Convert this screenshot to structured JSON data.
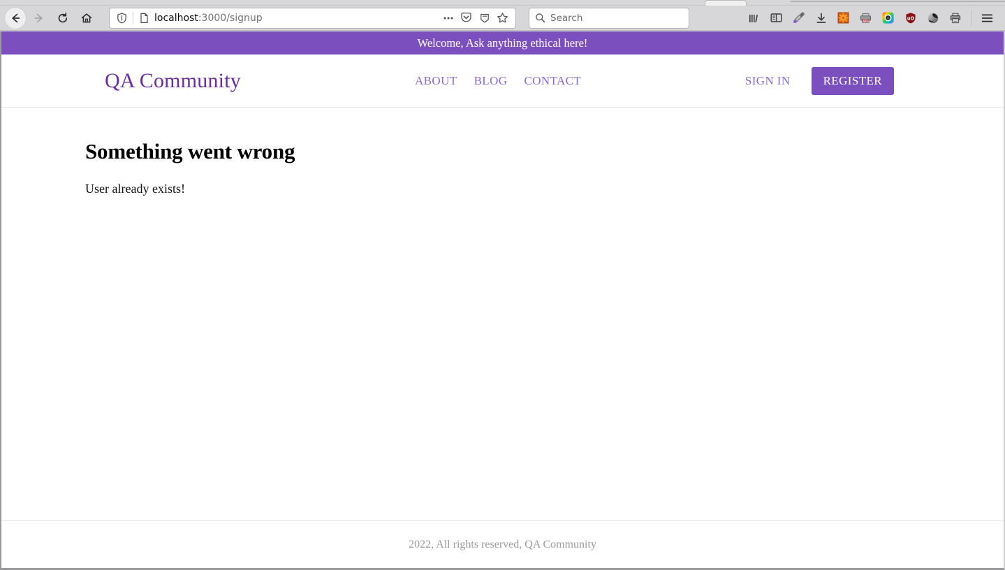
{
  "browser": {
    "nav": {
      "back_label": "Back",
      "forward_label": "Forward",
      "reload_label": "Reload",
      "home_label": "Home"
    },
    "url": {
      "host": "localhost",
      "path": ":3000/signup",
      "full": "localhost:3000/signup",
      "shield_label": "Tracking Protection",
      "page_info_label": "Page Info",
      "more_actions_label": "More actions",
      "pocket_label": "Save to Pocket",
      "reader_label": "Reader View",
      "bookmark_label": "Bookmark this page"
    },
    "search": {
      "placeholder": "Search",
      "value": ""
    },
    "extensions": [
      {
        "name": "library-icon",
        "label": "Library"
      },
      {
        "name": "sidebar-icon",
        "label": "Sidebars"
      },
      {
        "name": "eyedropper-icon",
        "label": "Eyedropper"
      },
      {
        "name": "download-icon",
        "label": "Downloads"
      },
      {
        "name": "orange-gear-icon",
        "label": "Settings Extension"
      },
      {
        "name": "pdf-printer-icon",
        "label": "Print to PDF"
      },
      {
        "name": "color-wheel-icon",
        "label": "Color Picker"
      },
      {
        "name": "ublock-shield-icon",
        "label": "uBlock Origin"
      },
      {
        "name": "dark-circle-icon",
        "label": "Extension"
      },
      {
        "name": "printer-icon",
        "label": "Print"
      },
      {
        "name": "hamburger-menu-icon",
        "label": "Open application menu"
      }
    ]
  },
  "page": {
    "announcement": "Welcome, Ask anything ethical here!",
    "header": {
      "logo": "QA Community",
      "nav": [
        {
          "label": "ABOUT"
        },
        {
          "label": "BLOG"
        },
        {
          "label": "CONTACT"
        }
      ],
      "sign_in_label": "SIGN IN",
      "register_label": "REGISTER"
    },
    "main": {
      "heading": "Something went wrong",
      "message": "User already exists!"
    },
    "footer": {
      "text": "2022, All rights reserved, QA Community"
    },
    "colors": {
      "brand_purple": "#7b50be",
      "logo_purple": "#6a2ca0",
      "nav_purple": "#8b68d4",
      "footer_gray": "#9b9b9b"
    }
  }
}
